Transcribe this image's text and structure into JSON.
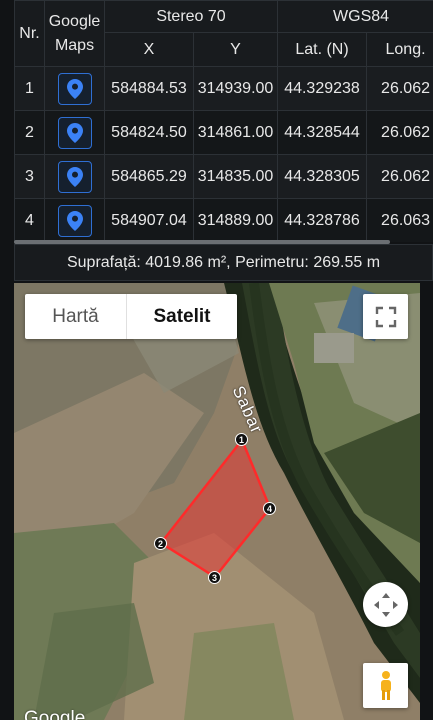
{
  "table": {
    "header": {
      "nr": "Nr.",
      "google_maps": "Google Maps",
      "stereo": "Stereo 70",
      "wgs": "WGS84",
      "x": "X",
      "y": "Y",
      "lat": "Lat. (N)",
      "long": "Long."
    },
    "rows": [
      {
        "nr": "1",
        "x": "584884.53",
        "y": "314939.00",
        "lat": "44.329238",
        "long": "26.062"
      },
      {
        "nr": "2",
        "x": "584824.50",
        "y": "314861.00",
        "lat": "44.328544",
        "long": "26.062"
      },
      {
        "nr": "3",
        "x": "584865.29",
        "y": "314835.00",
        "lat": "44.328305",
        "long": "26.062"
      },
      {
        "nr": "4",
        "x": "584907.04",
        "y": "314889.00",
        "lat": "44.328786",
        "long": "26.063"
      }
    ]
  },
  "summary": "Suprafață: 4019.86 m², Perimetru: 269.55 m",
  "map": {
    "type_map": "Hartă",
    "type_satellite": "Satelit",
    "selected_type": "Satelit",
    "river_label": "Sabar",
    "vertices": [
      "1",
      "2",
      "3",
      "4"
    ],
    "attribution": "Google",
    "polygon_color": "#e53935",
    "pin_color": "#3b82f6"
  }
}
